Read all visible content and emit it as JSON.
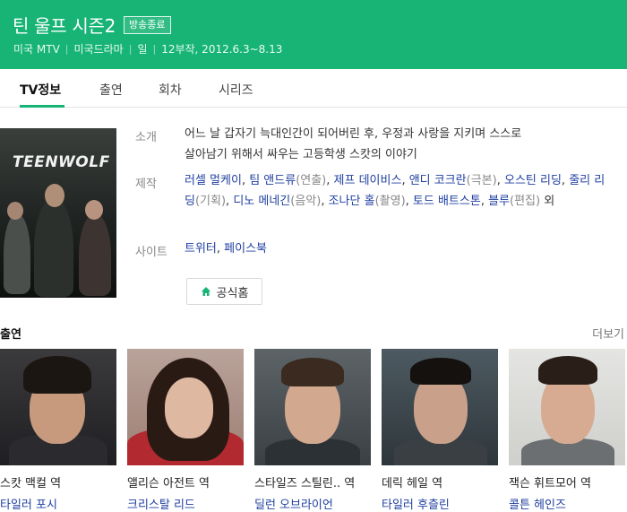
{
  "header": {
    "title": "틴 울프 시즌2",
    "badge": "방송종료",
    "meta": [
      "미국 MTV",
      "미국드라마",
      "일",
      "12부작, 2012.6.3~8.13"
    ],
    "separator": "|",
    "bg_color": "#17b475"
  },
  "tabs": [
    {
      "label": "TV정보",
      "active": true
    },
    {
      "label": "출연",
      "active": false
    },
    {
      "label": "회차",
      "active": false
    },
    {
      "label": "시리즈",
      "active": false
    }
  ],
  "poster": {
    "title": "TEENWOLF"
  },
  "info": {
    "intro_label": "소개",
    "intro_lines": [
      "어느 날 갑자기 늑대인간이 되어버린 후, 우정과 사랑을 지키며 스스로",
      "살아남기 위해서 싸우는 고등학생 스캇의 이야기"
    ],
    "production_label": "제작",
    "production": [
      {
        "name": "러셀 멀케이",
        "role": "",
        "sep": ", "
      },
      {
        "name": "팀 앤드류",
        "role": "(연출)",
        "sep": ", "
      },
      {
        "name": "제프 데이비스",
        "role": "",
        "sep": ", "
      },
      {
        "name": "앤디 코크란",
        "role": "(극본)",
        "sep": ", "
      },
      {
        "name": "오스틴 리딩",
        "role": "",
        "sep": ", "
      },
      {
        "name": "줄리 리딩",
        "role": "(기획)",
        "sep": ", "
      },
      {
        "name": "디노 메네긴",
        "role": "(음악)",
        "sep": ", "
      },
      {
        "name": "조나단 홀",
        "role": "(촬영)",
        "sep": ", "
      },
      {
        "name": "토드 배트스톤",
        "role": "",
        "sep": ", "
      },
      {
        "name": "블루",
        "role": "(편집)",
        "sep": " "
      }
    ],
    "production_suffix": "외",
    "site_label": "사이트",
    "sites": [
      "트위터",
      "페이스북"
    ],
    "site_sep": ", ",
    "home_button": "공식홈"
  },
  "cast": {
    "title": "출연",
    "more": "더보기",
    "items": [
      {
        "role": "스캇 맥컬 역",
        "actor": "타일러 포시"
      },
      {
        "role": "앨리슨 아전트 역",
        "actor": "크리스탈 리드"
      },
      {
        "role": "스타일즈 스틸린.. 역",
        "actor": "딜런 오브라이언"
      },
      {
        "role": "데릭 헤일 역",
        "actor": "타일러 후츨린"
      },
      {
        "role": "잭슨 휘트모어 역",
        "actor": "콜튼 헤인즈"
      }
    ]
  },
  "colors": {
    "accent": "#17b475",
    "link": "#1f3fa0",
    "muted": "#888888"
  }
}
